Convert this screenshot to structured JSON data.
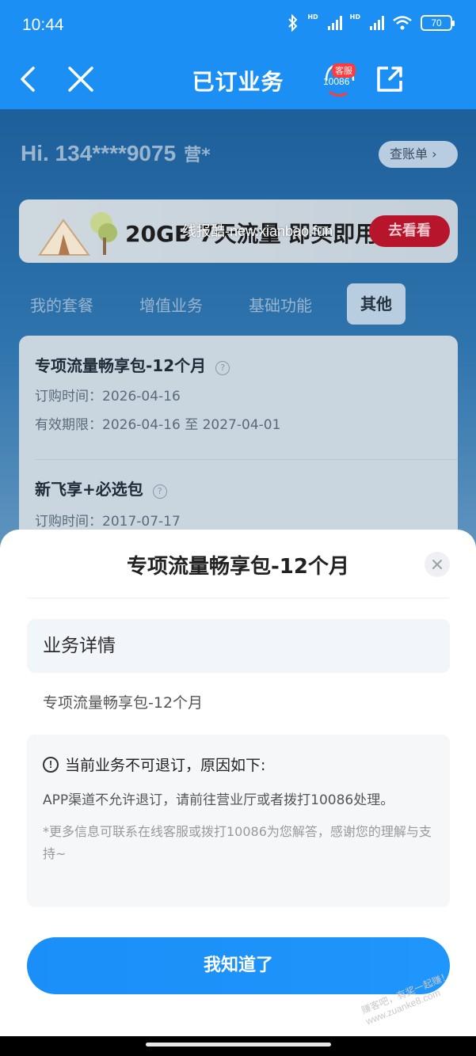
{
  "status_bar": {
    "time": "10:44",
    "hd1": "HD",
    "hd2": "HD",
    "battery": "70"
  },
  "nav": {
    "title": "已订业务",
    "cs_badge": "客服",
    "cs_number": "10086"
  },
  "background": {
    "greeting": "Hi. 134****9075",
    "greeting_suffix": "营*",
    "bill_button": "查账单 ›",
    "banner_text": "20GB 7天流量 即买即用",
    "banner_watermark": "线报酷-new.xianbao.fun",
    "banner_button": "去看看",
    "tabs": [
      "我的套餐",
      "增值业务",
      "基础功能",
      "其他"
    ],
    "active_tab": "其他",
    "items": [
      {
        "name": "专项流量畅享包-12个月",
        "order_time": "订购时间：2026-04-16",
        "validity": "有效期限：2026-04-16 至 2027-04-01"
      },
      {
        "name": "新飞享+必选包",
        "order_time": "订购时间：2017-07-17"
      }
    ]
  },
  "sheet": {
    "title": "专项流量畅享包-12个月",
    "detail_header": "业务详情",
    "detail_text": "专项流量畅享包-12个月",
    "warning_title": "当前业务不可退订，原因如下:",
    "warning_body": "APP渠道不允许退订，请前往营业厅或者拨打10086处理。",
    "warning_note": "*更多信息可联系在线客服或拨打10086为您解答，感谢您的理解与支持~",
    "confirm_button": "我知道了"
  },
  "watermark": "赚客吧，有奖一起赚！www.zuanke8.com",
  "colors": {
    "primary": "#1c8ff5",
    "button": "#1a8ff8"
  }
}
